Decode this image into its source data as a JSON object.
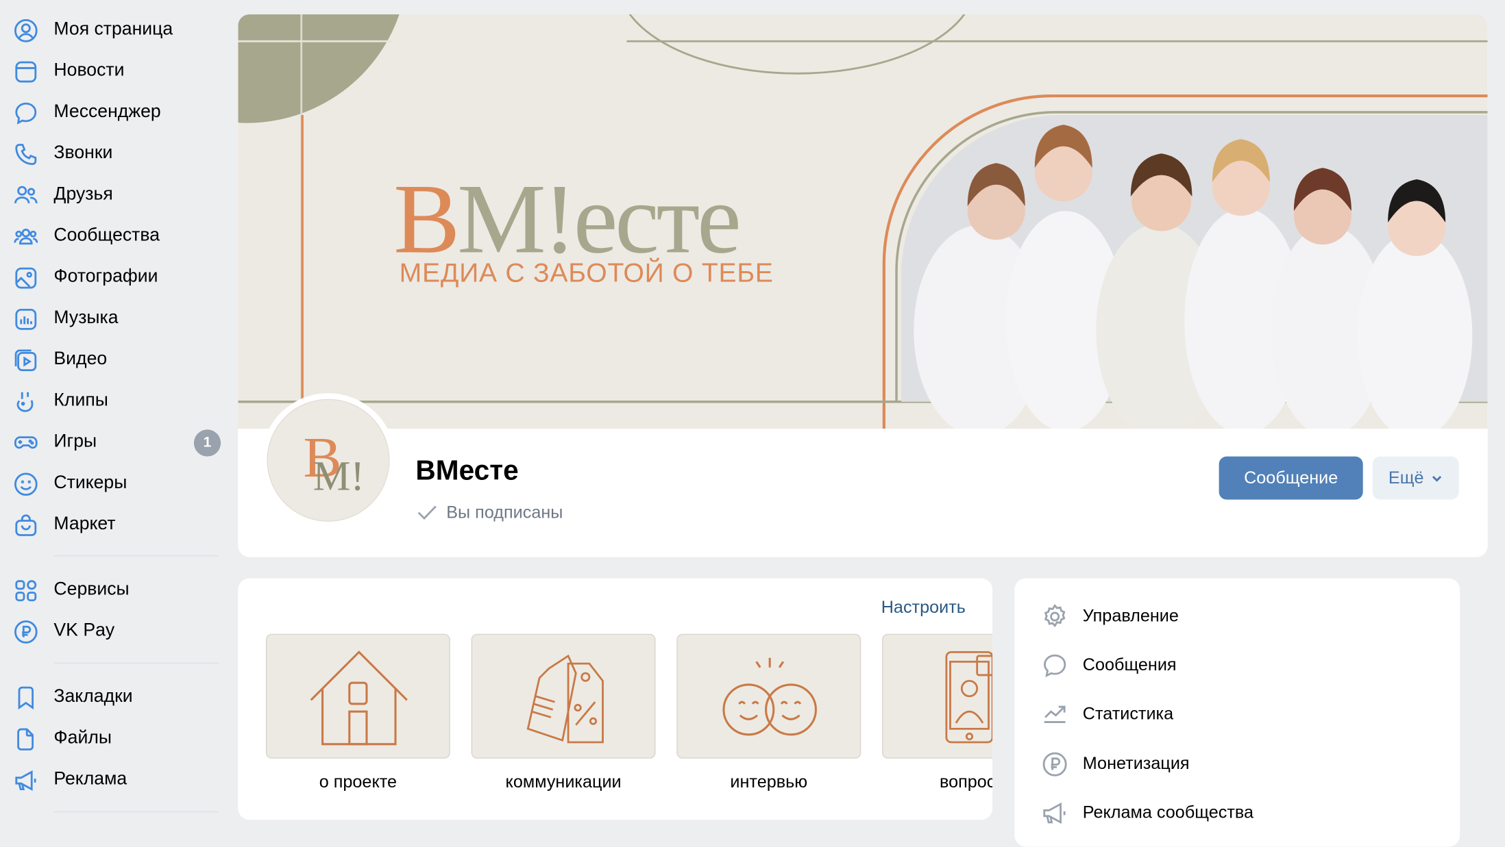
{
  "sidebar": {
    "items": [
      {
        "label": "Моя страница",
        "icon": "user-circle-icon"
      },
      {
        "label": "Новости",
        "icon": "news-icon"
      },
      {
        "label": "Мессенджер",
        "icon": "chat-bubble-icon"
      },
      {
        "label": "Звонки",
        "icon": "phone-icon"
      },
      {
        "label": "Друзья",
        "icon": "friends-icon"
      },
      {
        "label": "Сообщества",
        "icon": "communities-icon"
      },
      {
        "label": "Фотографии",
        "icon": "photo-icon"
      },
      {
        "label": "Музыка",
        "icon": "music-icon"
      },
      {
        "label": "Видео",
        "icon": "video-icon"
      },
      {
        "label": "Клипы",
        "icon": "clips-icon"
      },
      {
        "label": "Игры",
        "icon": "gamepad-icon",
        "badge": "1"
      },
      {
        "label": "Стикеры",
        "icon": "smile-icon"
      },
      {
        "label": "Маркет",
        "icon": "market-bag-icon"
      }
    ],
    "items2": [
      {
        "label": "Сервисы",
        "icon": "services-grid-icon"
      },
      {
        "label": "VK Pay",
        "icon": "ruble-icon"
      }
    ],
    "items3": [
      {
        "label": "Закладки",
        "icon": "bookmark-icon"
      },
      {
        "label": "Файлы",
        "icon": "file-icon"
      },
      {
        "label": "Реклама",
        "icon": "megaphone-icon"
      }
    ]
  },
  "cover": {
    "brand_part1": "В",
    "brand_part2": "M!ecте",
    "tagline": "МЕДИА С ЗАБОТОЙ О ТЕБЕ",
    "colors": {
      "accent_orange": "#dd8a58",
      "accent_olive": "#a6a78d",
      "background": "#edeae3"
    }
  },
  "group": {
    "avatar_letter1": "В",
    "avatar_letter2": "M!",
    "name": "ВМесте",
    "subscribed_text": "Вы подписаны",
    "message_button": "Сообщение",
    "more_button": "Ещё"
  },
  "widgets": {
    "configure_label": "Настроить",
    "tiles": [
      {
        "label": "о проекте",
        "icon": "house-icon"
      },
      {
        "label": "коммуникации",
        "icon": "price-tags-icon"
      },
      {
        "label": "интервью",
        "icon": "two-faces-icon"
      },
      {
        "label": "вопрос/c",
        "icon": "phone-chat-icon"
      }
    ]
  },
  "manage_menu": {
    "items": [
      {
        "label": "Управление",
        "icon": "gear-icon"
      },
      {
        "label": "Сообщения",
        "icon": "chat-bubble-icon"
      },
      {
        "label": "Статистика",
        "icon": "stats-chart-icon"
      },
      {
        "label": "Монетизация",
        "icon": "ruble-icon"
      },
      {
        "label": "Реклама сообщества",
        "icon": "megaphone-icon"
      }
    ]
  },
  "theme": {
    "link_blue": "#2a5885",
    "button_blue": "#5181b8",
    "icon_blue": "#3f8ae0"
  }
}
